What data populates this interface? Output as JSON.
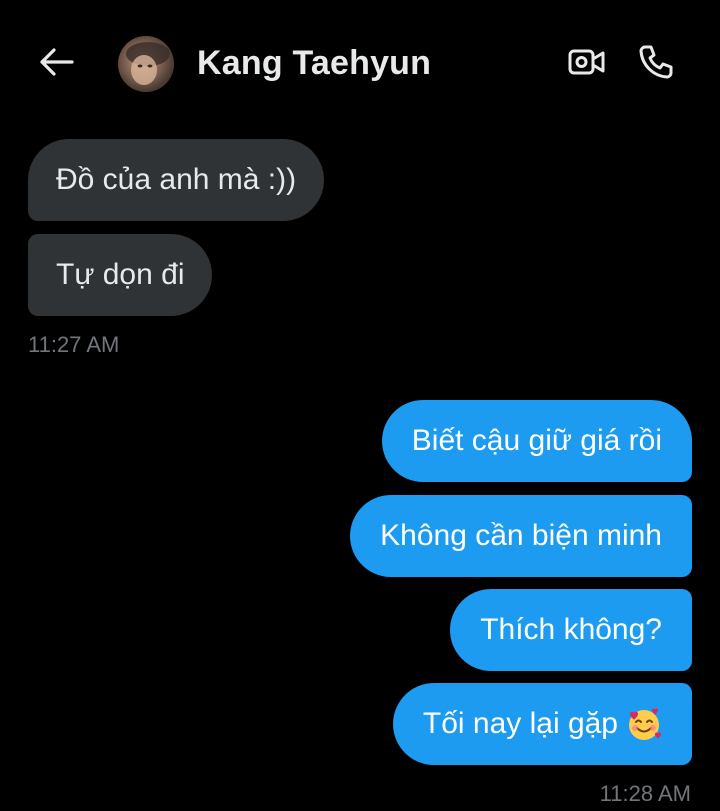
{
  "header": {
    "contact_name": "Kang Taehyun",
    "back_icon": "arrow-left-icon",
    "video_icon": "video-call-icon",
    "call_icon": "phone-icon"
  },
  "messages": {
    "incoming": [
      {
        "text": "Đồ của anh mà :))"
      },
      {
        "text": "Tự dọn đi"
      }
    ],
    "incoming_time": "11:27 AM",
    "outgoing": [
      {
        "text": "Biết cậu giữ giá rồi"
      },
      {
        "text": "Không cần biện minh"
      },
      {
        "text": "Thích không?"
      },
      {
        "text": "Tối nay lại gặp",
        "emoji": "smiling-face-with-hearts-emoji"
      }
    ],
    "outgoing_time": "11:28 AM"
  },
  "colors": {
    "background": "#000000",
    "incoming_bubble": "#2f3336",
    "outgoing_bubble": "#1d9bf0",
    "timestamp": "#71767b"
  }
}
